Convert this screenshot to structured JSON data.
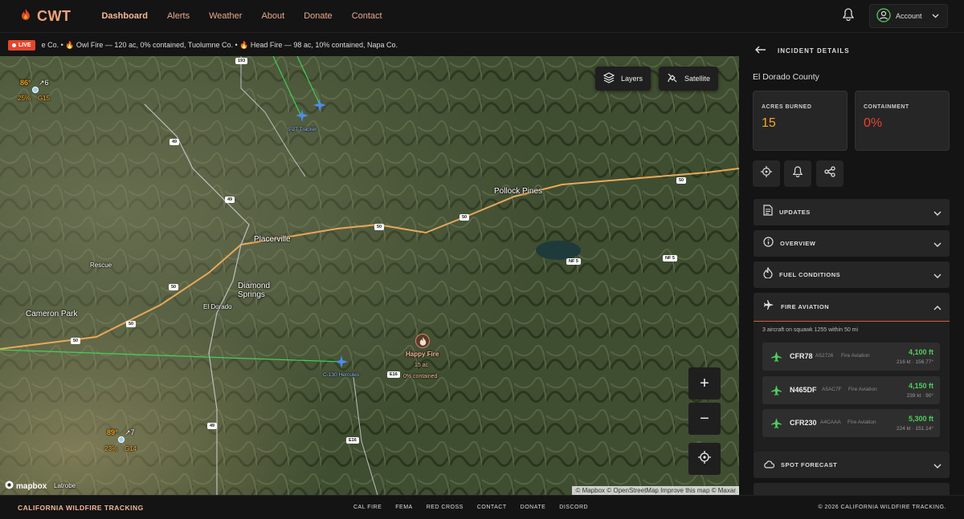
{
  "nav": {
    "brand": "CWT",
    "links": [
      "Dashboard",
      "Alerts",
      "Weather",
      "About",
      "Donate",
      "Contact"
    ],
    "account_label": "Account"
  },
  "ticker": {
    "live_label": "LIVE",
    "text": "e Co. • 🔥 Owl Fire — 120 ac, 0% contained, Tuolumne Co. • 🔥 Head Fire — 98 ac, 10% contained, Napa Co."
  },
  "map": {
    "layers_label": "Layers",
    "satellite_label": "Satellite",
    "zoom_in": "+",
    "zoom_out": "−",
    "attribution": "© Mapbox © OpenStreetMap  Improve this map  © Maxar",
    "mapbox_logo": "mapbox",
    "places": [
      "Pollock Pines",
      "Placerville",
      "Diamond Springs",
      "El Dorado",
      "Cameron Park",
      "Rescue",
      "Latrobe"
    ],
    "shields": [
      "193",
      "49",
      "49",
      "50",
      "50",
      "50",
      "50",
      "50",
      "50",
      "E16",
      "E16",
      "49",
      "NF 5",
      "NF 5"
    ],
    "aircraft": [
      {
        "label": "S-2T Tracker"
      },
      {
        "label": "C-130 Hercules"
      }
    ],
    "fire": {
      "name": "Happy Fire",
      "acres": "15 ac",
      "contained": "0% contained"
    },
    "weather_stations": [
      {
        "temp": "86°",
        "wind": "↗6",
        "humidity": "25%",
        "gust": "G15"
      },
      {
        "temp": "89°",
        "wind": "↗7",
        "humidity": "23%",
        "gust": "G14"
      }
    ]
  },
  "panel": {
    "title": "INCIDENT DETAILS",
    "county": "El Dorado County",
    "acres_label": "ACRES BURNED",
    "acres_value": "15",
    "containment_label": "CONTAINMENT",
    "containment_value": "0%",
    "sections": [
      "UPDATES",
      "OVERVIEW",
      "FUEL CONDITIONS",
      "FIRE AVIATION",
      "SPOT FORECAST"
    ],
    "aviation_summary": "3 aircraft on squawk 1255 within 50 mi",
    "aircraft": [
      {
        "callsign": "CFR78",
        "hex": "A52726",
        "type": "Fire Aviation",
        "alt": "4,100 ft",
        "speed": "216 kt · 156.77°"
      },
      {
        "callsign": "N465DF",
        "hex": "A5AC7F",
        "type": "Fire Aviation",
        "alt": "4,150 ft",
        "speed": "239 kt · 90°"
      },
      {
        "callsign": "CFR230",
        "hex": "A4CAAA",
        "type": "Fire Aviation",
        "alt": "5,300 ft",
        "speed": "224 kt · 151.14°"
      }
    ]
  },
  "footer": {
    "brand": "CALIFORNIA WILDFIRE TRACKING",
    "links": [
      "CAL FIRE",
      "FEMA",
      "RED CROSS",
      "CONTACT",
      "DONATE",
      "DISCORD"
    ],
    "copyright": "© 2026 CALIFORNIA WILDFIRE TRACKING."
  },
  "colors": {
    "accent": "#f0a27a",
    "fire_orange": "#f5a623",
    "red": "#e8432f",
    "green": "#4fce5e"
  }
}
